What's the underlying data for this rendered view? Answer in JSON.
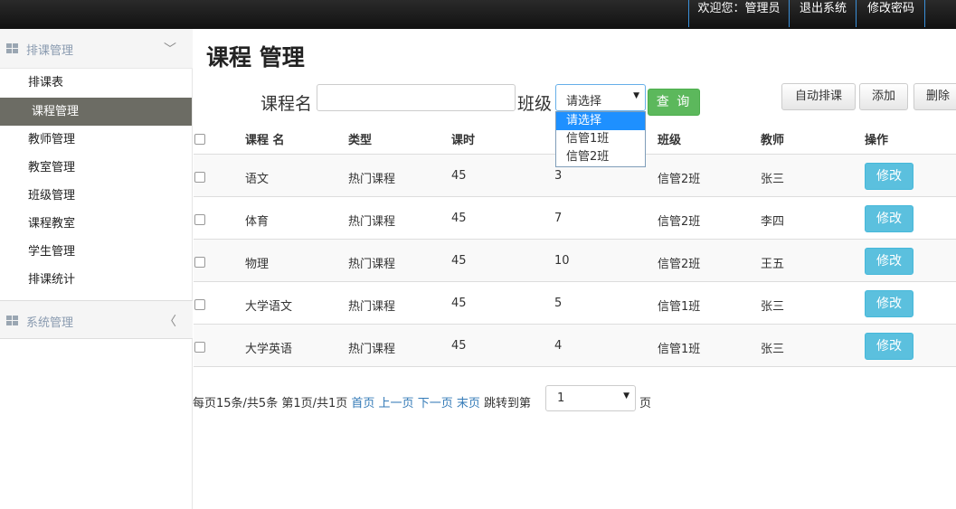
{
  "topbar": {
    "welcome": "欢迎您：管理员",
    "logout": "退出系统",
    "change_password": "修改密码"
  },
  "sidebar": {
    "group1": {
      "label": "排课管理",
      "arrow": "﹀"
    },
    "items": [
      {
        "label": "排课表"
      },
      {
        "label": "课程管理"
      },
      {
        "label": "教师管理"
      },
      {
        "label": "教室管理"
      },
      {
        "label": "班级管理"
      },
      {
        "label": "课程教室"
      },
      {
        "label": "学生管理"
      },
      {
        "label": "排课统计"
      }
    ],
    "group2": {
      "label": "系统管理",
      "arrow": "〈"
    }
  },
  "main": {
    "title": "课程 管理",
    "filter": {
      "course_label": "课程名",
      "course_value": "",
      "class_label": "班级",
      "class_selected": "请选择",
      "class_options": [
        "请选择",
        "信管1班",
        "信管2班"
      ],
      "query_label": "查 询"
    },
    "buttons": {
      "auto": "自动排课",
      "add": "添加",
      "delete": "删除"
    },
    "table": {
      "headers": [
        "课程 名",
        "类型",
        "课时",
        "",
        "班级",
        "教师",
        "操作"
      ],
      "rows": [
        {
          "name": "语文",
          "type": "热门课程",
          "hours": "45",
          "num": "3",
          "class": "信管2班",
          "teacher": "张三",
          "action": "修改"
        },
        {
          "name": "体育",
          "type": "热门课程",
          "hours": "45",
          "num": "7",
          "class": "信管2班",
          "teacher": "李四",
          "action": "修改"
        },
        {
          "name": "物理",
          "type": "热门课程",
          "hours": "45",
          "num": "10",
          "class": "信管2班",
          "teacher": "王五",
          "action": "修改"
        },
        {
          "name": "大学语文",
          "type": "热门课程",
          "hours": "45",
          "num": "5",
          "class": "信管1班",
          "teacher": "张三",
          "action": "修改"
        },
        {
          "name": "大学英语",
          "type": "热门课程",
          "hours": "45",
          "num": "4",
          "class": "信管1班",
          "teacher": "张三",
          "action": "修改"
        }
      ]
    },
    "pager": {
      "summary": "每页15条/共5条 第1页/共1页",
      "first": "首页",
      "prev": "上一页",
      "next": "下一页",
      "last": "末页",
      "jump_label": "跳转到第",
      "page_value": "1",
      "page_unit": "页"
    }
  },
  "colors": {
    "topbar": "#111111",
    "active_sidebar": "#6c6c64",
    "query_button": "#5cb85c",
    "edit_button": "#5bc0de",
    "link": "#337ab7",
    "dropdown_highlight": "#1e90ff"
  }
}
